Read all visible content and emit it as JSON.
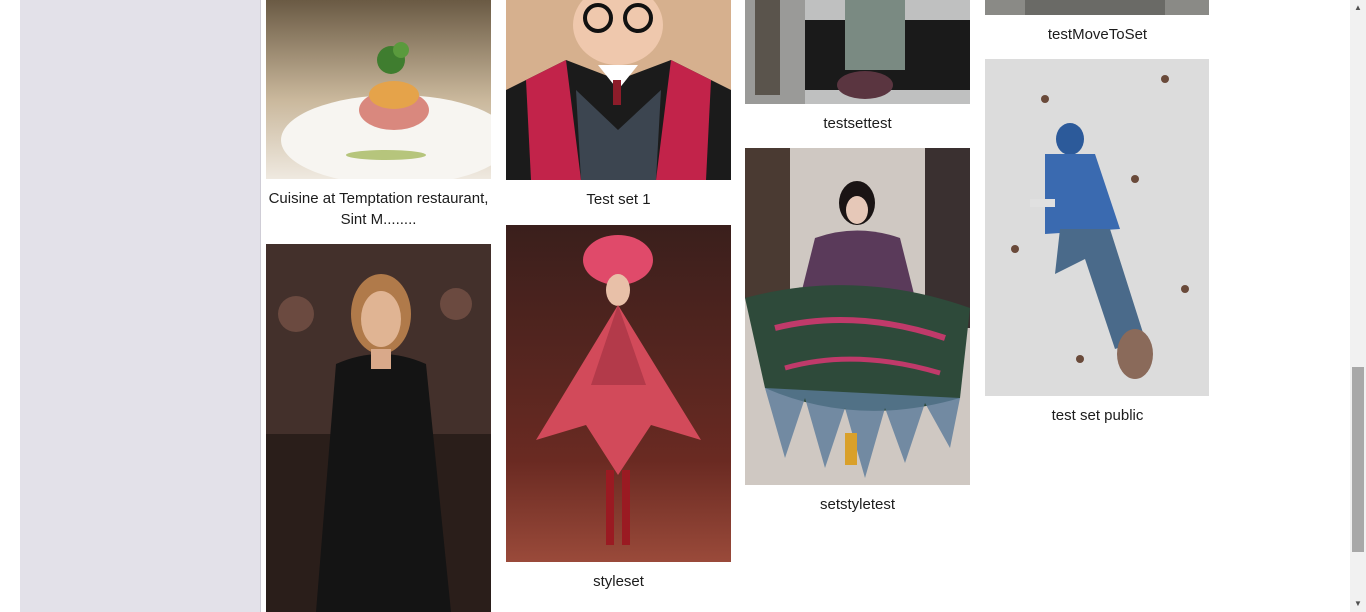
{
  "sidebar": {},
  "gallery": {
    "items": [
      {
        "caption": "Cuisine at Temptation restaurant, Sint M........",
        "image": "plated-dish-photo"
      },
      {
        "caption": "",
        "image": "woman-black-suit-photo"
      },
      {
        "caption": "Test set 1",
        "image": "wizard-doll-photo"
      },
      {
        "caption": "styleset",
        "image": "runway-red-cape-photo"
      },
      {
        "caption": "testsettest",
        "image": "street-shoppers-photo"
      },
      {
        "caption": "setstyletest",
        "image": "runway-fringe-coat-photo"
      },
      {
        "caption": "testMoveToSet",
        "image": "cropped-photo"
      },
      {
        "caption": "test set public",
        "image": "climbing-wall-photo"
      }
    ]
  },
  "scrollbar": {
    "up_icon": "chevron-up-icon",
    "down_icon": "chevron-down-icon"
  }
}
